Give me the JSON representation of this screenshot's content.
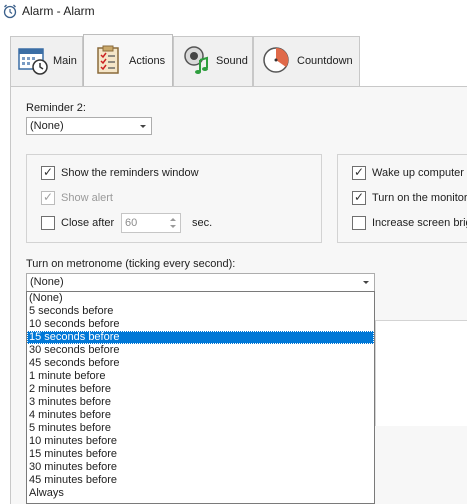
{
  "window": {
    "title": "Alarm - Alarm"
  },
  "tabs": [
    {
      "label": "Main",
      "icon": "calendar-clock-icon",
      "active": false
    },
    {
      "label": "Actions",
      "icon": "checklist-icon",
      "active": true
    },
    {
      "label": "Sound",
      "icon": "speaker-note-icon",
      "active": false
    },
    {
      "label": "Countdown",
      "icon": "countdown-icon",
      "active": false
    }
  ],
  "reminder": {
    "label": "Reminder 2:",
    "value": "(None)"
  },
  "reminders_group": {
    "show_window": {
      "label": "Show the reminders window",
      "checked": true
    },
    "show_alert": {
      "label": "Show alert",
      "checked": true,
      "enabled": false
    },
    "close_after": {
      "label": "Close after",
      "checked": false,
      "value": "60",
      "unit": "sec."
    }
  },
  "power_group": {
    "wake_up": {
      "label": "Wake up computer t",
      "checked": true
    },
    "turn_on_monitor": {
      "label": "Turn on the monitor",
      "checked": true
    },
    "increase_brightness": {
      "label": "Increase screen brig",
      "checked": false
    }
  },
  "metronome": {
    "label": "Turn on metronome (ticking every second):",
    "value": "(None)",
    "options": [
      "(None)",
      "5 seconds before",
      "10 seconds before",
      "15 seconds before",
      "30 seconds before",
      "45 seconds before",
      "1 minute before",
      "2 minutes before",
      "3 minutes before",
      "4 minutes before",
      "5 minutes before",
      "10 minutes before",
      "15 minutes before",
      "30 minutes before",
      "45 minutes before",
      "Always"
    ],
    "highlighted_option": "15 seconds before"
  },
  "colors": {
    "selection": "#0078d7",
    "panel": "#f7f7f7"
  }
}
